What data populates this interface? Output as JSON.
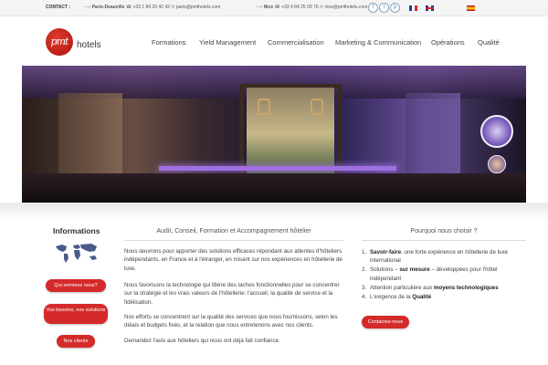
{
  "topbar": {
    "contact_label": "CONTACT :",
    "paris_city": "Paris-Deauville",
    "paris_phone": "+33 1 84 20 42 42",
    "paris_email": "paris@pmthotels.com",
    "nice_city": "Nice",
    "nice_phone": "+33 4 84 25 09 76",
    "nice_email": "nice@pmthotels.com",
    "social_icons": [
      "facebook-icon",
      "twitter-icon",
      "pinterest-icon"
    ],
    "flags": [
      "fr",
      "uk",
      "es"
    ]
  },
  "header": {
    "logo_mark": "pmt",
    "logo_text": "hotels",
    "nav": [
      "Formations",
      "Yield Management",
      "Commercialisation",
      "Marketing & Communication",
      "Opérations",
      "Qualité"
    ]
  },
  "left": {
    "title": "Informations",
    "buttons": [
      "Qui sommes nous?",
      "Vos besoins, nos solutions",
      "Nos clients"
    ]
  },
  "middle": {
    "title": "Audit, Conseil, Formation et Accompagnement hôtelier",
    "paragraphs": [
      "Nous œuvrons pour apporter des solutions efficaces répondant aux attentes d'hôteliers indépendants, en France et à l'étranger, en misant sur nos expériences en hôtellerie de luxe.",
      "Nous favorisons la technologie qui libère des taches fonctionnelles pour se concentrer sur la stratégie et les vrais valeurs de l'hôtellerie: l'accueil, la qualité de service et la fidélisation.",
      "Nos efforts se concentrent sur la qualité des services que nous fournissons, selon les délais et budgets fixés, et la relation que nous entretenons avec nos clients.",
      "Demandez l'avis aux hôteliers qui nous ont déjà fait confiance."
    ]
  },
  "right": {
    "title": "Pourquoi nous choisir ?",
    "reasons": [
      {
        "num": "1.",
        "bold": "Savoir-faire",
        "rest": ", une forte expérience en hôtellerie de luxe international"
      },
      {
        "num": "2.",
        "pre": "Solutions – ",
        "bold": "sur mesure",
        "rest": " – développées pour l'hôtel indépendant"
      },
      {
        "num": "3.",
        "pre": "Attention particulière aux ",
        "bold": "moyens technologiques"
      },
      {
        "num": "4.",
        "pre": "L'exigence de la ",
        "bold": "Qualité"
      }
    ],
    "button": "Contactez-nous"
  },
  "colors": {
    "accent": "#d42a2a",
    "banner_purple": "#6f58a3"
  }
}
